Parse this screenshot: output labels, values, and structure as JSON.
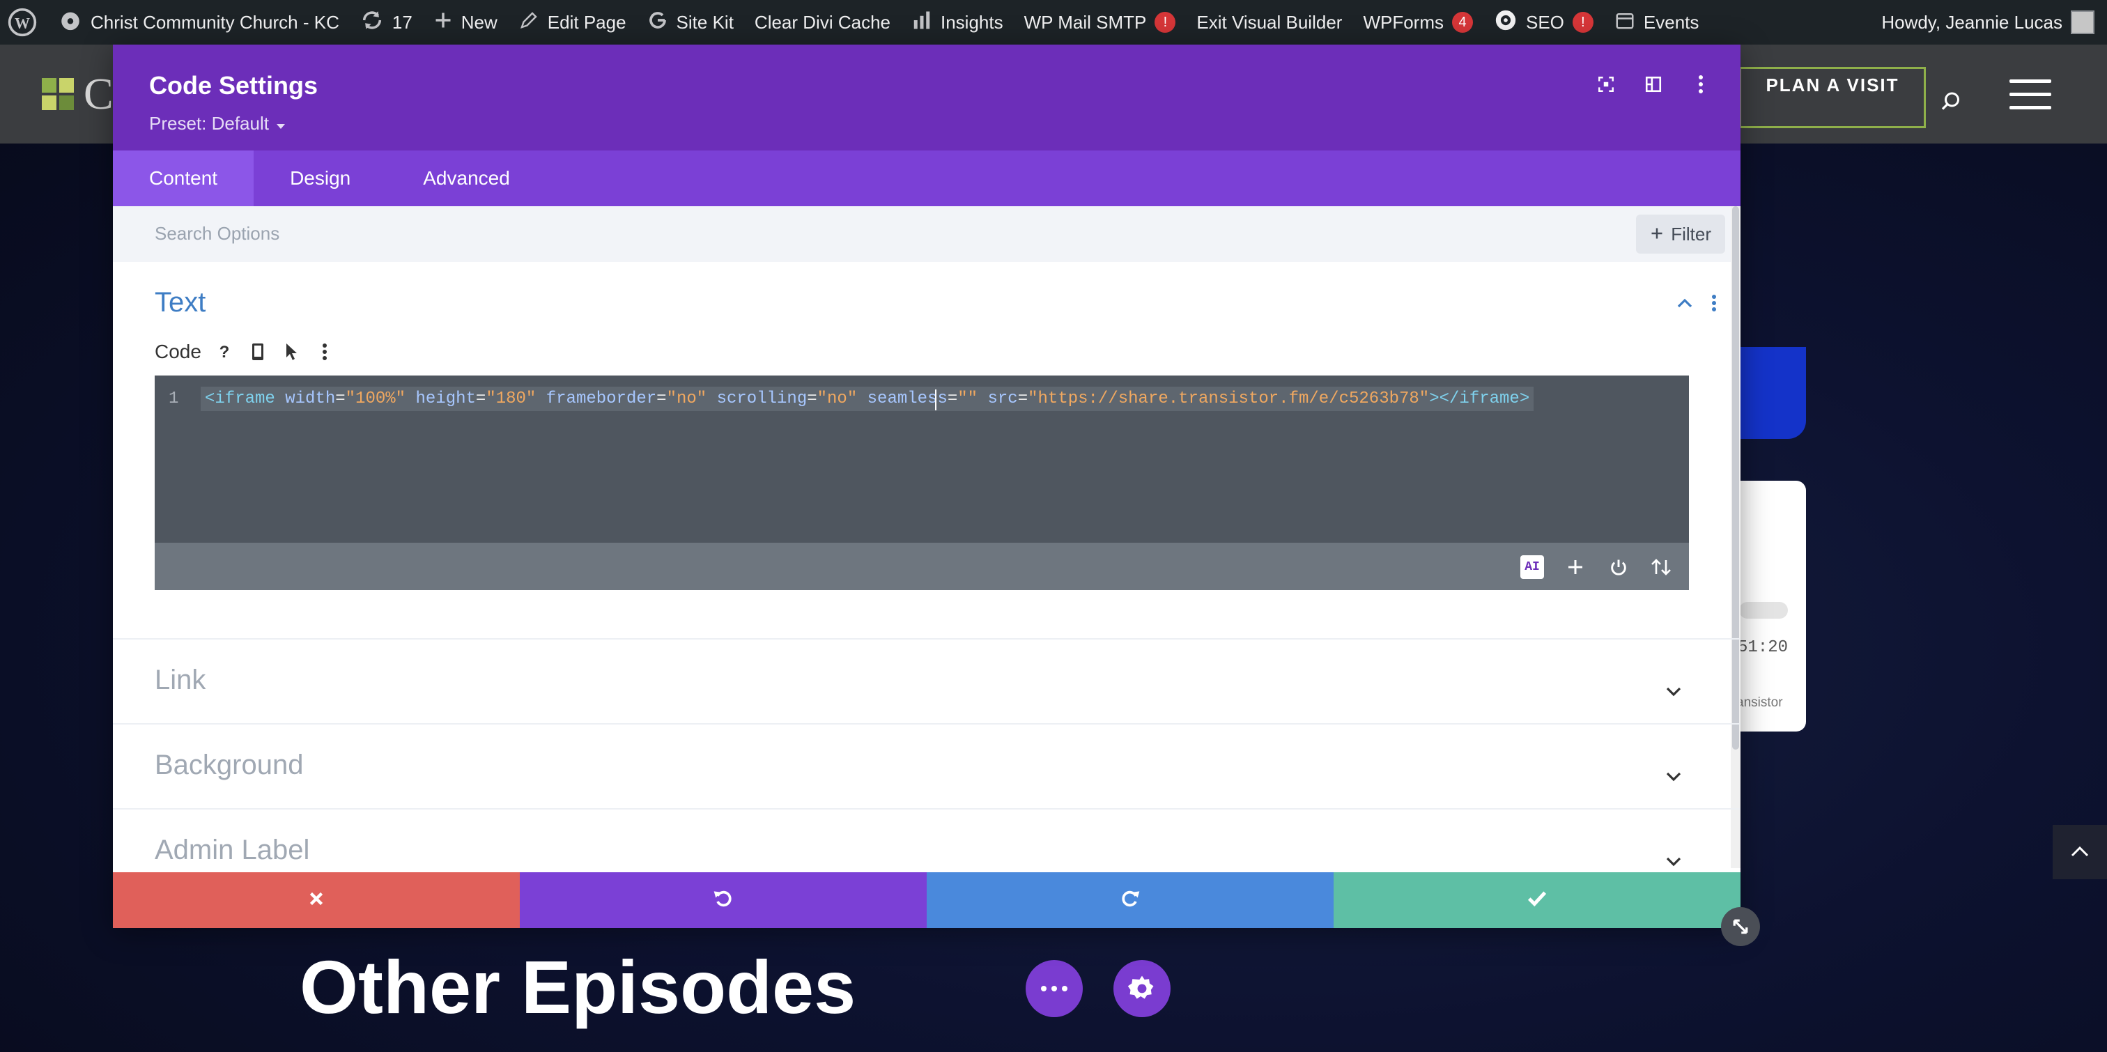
{
  "admin_bar": {
    "site_name": "Christ Community Church - KC",
    "updates_count": "17",
    "new_label": "New",
    "edit_page_label": "Edit Page",
    "site_kit_label": "Site Kit",
    "clear_cache_label": "Clear Divi Cache",
    "insights_label": "Insights",
    "wp_mail_label": "WP Mail SMTP",
    "wp_mail_badge": "!",
    "exit_builder_label": "Exit Visual Builder",
    "wpforms_label": "WPForms",
    "wpforms_badge": "4",
    "seo_label": "SEO",
    "seo_badge": "!",
    "events_label": "Events",
    "greeting": "Howdy, Jeannie Lucas"
  },
  "site": {
    "logo_letter": "C",
    "plan_visit_label": "PLAN A VISIT",
    "player_time": "51:20",
    "player_brand": "ansistor",
    "heading": "Other Episodes"
  },
  "modal": {
    "title": "Code Settings",
    "preset": "Preset: Default",
    "tabs": [
      "Content",
      "Design",
      "Advanced"
    ],
    "search_placeholder": "Search Options",
    "filter_label": "Filter",
    "section_text": {
      "title": "Text",
      "code_label": "Code",
      "line_number": "1",
      "code": {
        "open": "<iframe",
        "width_attr": "width",
        "width_val": "\"100%\"",
        "height_attr": "height",
        "height_val": "\"180\"",
        "frameborder_attr": "frameborder",
        "frameborder_val": "\"no\"",
        "scrolling_attr": "scrolling",
        "scrolling_val": "\"no\"",
        "seamless_attr": "seamless",
        "seamless_val": "\"\"",
        "src_attr": "src",
        "src_val": "\"https://share.transistor.fm/e/c5263b78\"",
        "close": "></iframe>"
      },
      "ai_chip": "AI"
    },
    "sections": [
      "Link",
      "Background",
      "Admin Label"
    ]
  },
  "colors": {
    "modal_header": "#6c2eb9",
    "tabs_bar": "#7b40d6",
    "section_title": "#3e7dc4",
    "cancel": "#e0605a",
    "undo": "#7b40d6",
    "redo": "#4a89dc",
    "save": "#5ebfa5"
  }
}
